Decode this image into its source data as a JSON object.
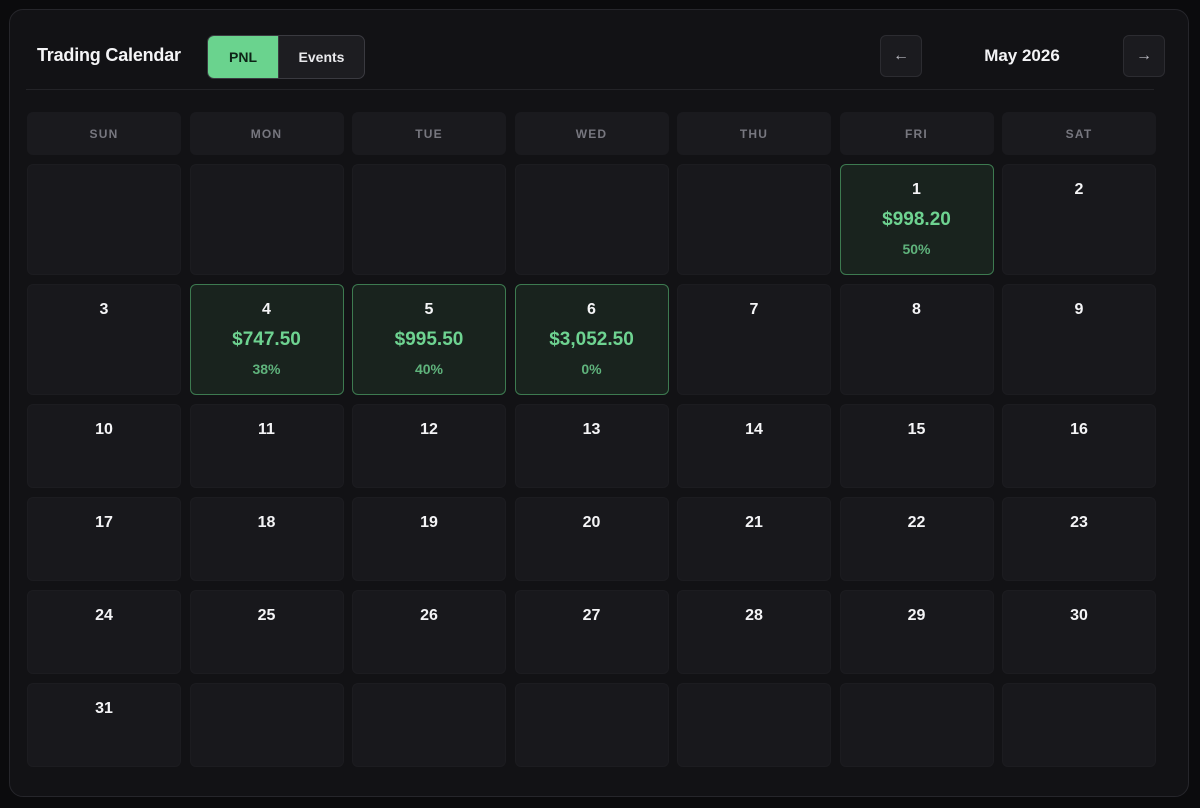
{
  "header": {
    "title": "Trading Calendar",
    "toggle": {
      "pnl_label": "PNL",
      "events_label": "Events",
      "active": "PNL"
    },
    "prev_icon": "←",
    "next_icon": "→",
    "month_label": "May 2026"
  },
  "weekdays": [
    "SUN",
    "MON",
    "TUE",
    "WED",
    "THU",
    "FRI",
    "SAT"
  ],
  "colors": {
    "accent": "#6ad38e",
    "profit_bg": "#19231e",
    "profit_border": "#3d7a50",
    "cell_bg": "#18181c"
  },
  "weeks": [
    [
      {
        "day": ""
      },
      {
        "day": ""
      },
      {
        "day": ""
      },
      {
        "day": ""
      },
      {
        "day": ""
      },
      {
        "day": "1",
        "pnl": "$998.20",
        "pct": "50%"
      },
      {
        "day": "2"
      }
    ],
    [
      {
        "day": "3"
      },
      {
        "day": "4",
        "pnl": "$747.50",
        "pct": "38%"
      },
      {
        "day": "5",
        "pnl": "$995.50",
        "pct": "40%"
      },
      {
        "day": "6",
        "pnl": "$3,052.50",
        "pct": "0%"
      },
      {
        "day": "7"
      },
      {
        "day": "8"
      },
      {
        "day": "9"
      }
    ],
    [
      {
        "day": "10"
      },
      {
        "day": "11"
      },
      {
        "day": "12"
      },
      {
        "day": "13"
      },
      {
        "day": "14"
      },
      {
        "day": "15"
      },
      {
        "day": "16"
      }
    ],
    [
      {
        "day": "17"
      },
      {
        "day": "18"
      },
      {
        "day": "19"
      },
      {
        "day": "20"
      },
      {
        "day": "21"
      },
      {
        "day": "22"
      },
      {
        "day": "23"
      }
    ],
    [
      {
        "day": "24"
      },
      {
        "day": "25"
      },
      {
        "day": "26"
      },
      {
        "day": "27"
      },
      {
        "day": "28"
      },
      {
        "day": "29"
      },
      {
        "day": "30"
      }
    ],
    [
      {
        "day": "31"
      },
      {
        "day": ""
      },
      {
        "day": ""
      },
      {
        "day": ""
      },
      {
        "day": ""
      },
      {
        "day": ""
      },
      {
        "day": ""
      }
    ]
  ]
}
